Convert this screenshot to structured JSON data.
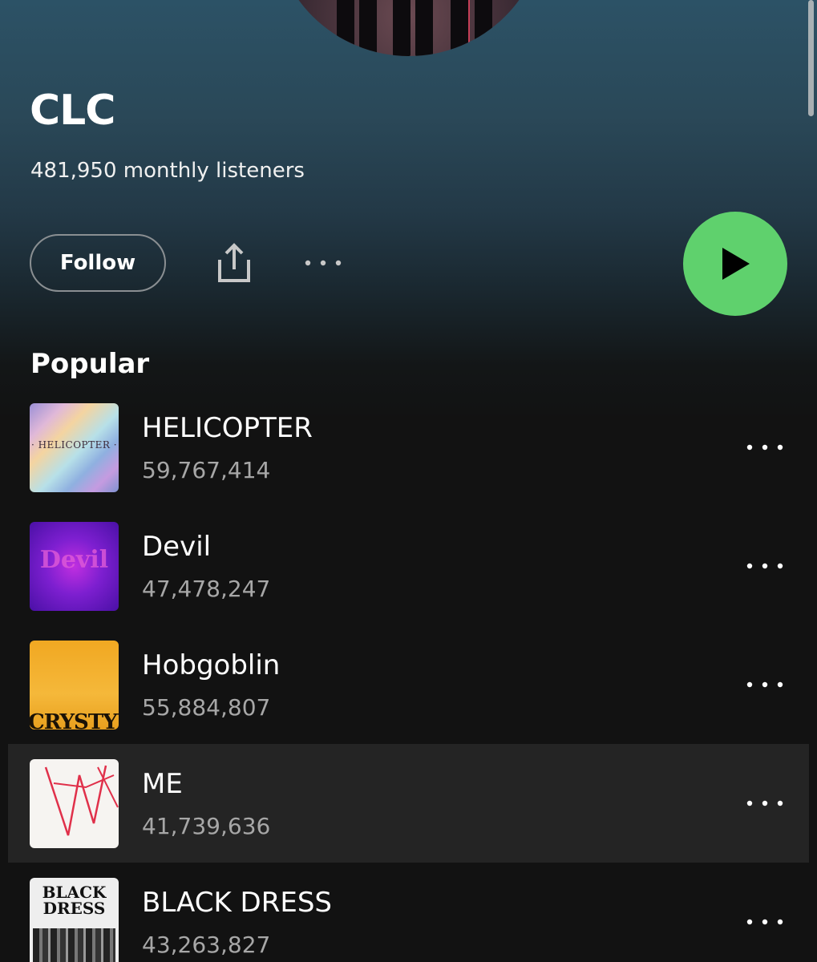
{
  "artist": {
    "name": "CLC",
    "monthly_listeners": "481,950 monthly listeners"
  },
  "actions": {
    "follow_label": "Follow",
    "share_icon": "share-icon",
    "more_icon": "more-options-icon",
    "play_icon": "play-icon",
    "play_color": "#5fd16d"
  },
  "popular": {
    "title": "Popular",
    "tracks": [
      {
        "title": "HELICOPTER",
        "plays": "59,767,414",
        "art_text": "· HELICOPTER ·"
      },
      {
        "title": "Devil",
        "plays": "47,478,247",
        "art_text": "Devil"
      },
      {
        "title": "Hobgoblin",
        "plays": "55,884,807",
        "art_text": "CRYSTYLE"
      },
      {
        "title": "ME",
        "plays": "41,739,636",
        "art_text": ""
      },
      {
        "title": "BLACK DRESS",
        "plays": "43,263,827",
        "art_text": "BLACK DRESS"
      }
    ]
  }
}
